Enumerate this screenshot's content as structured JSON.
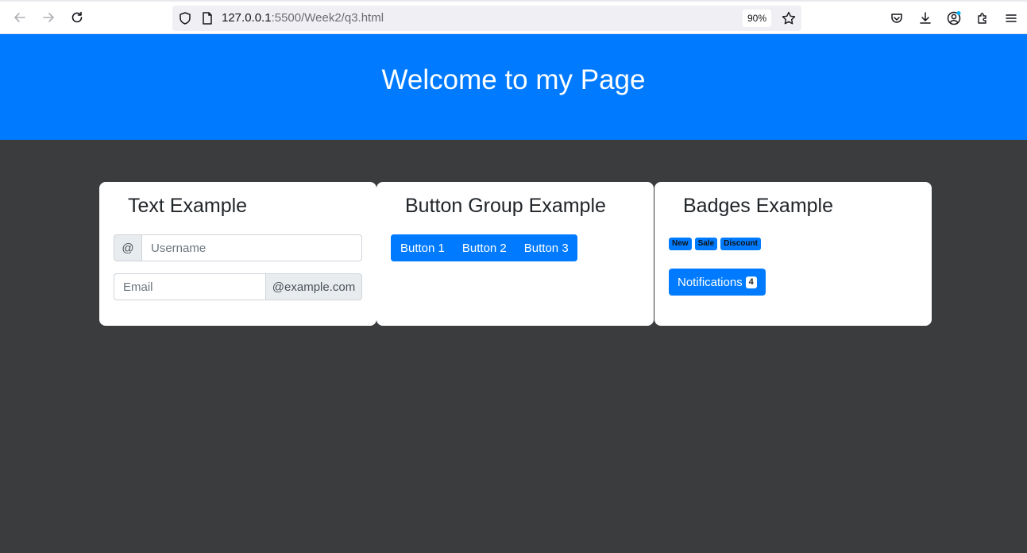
{
  "browser": {
    "url_host": "127.0.0.1",
    "url_path": ":5500/Week2/q3.html",
    "zoom": "90%",
    "icons": [
      "back-icon",
      "forward-icon",
      "reload-icon",
      "shield-icon",
      "page-icon",
      "star-icon",
      "pocket-icon",
      "download-icon",
      "account-icon",
      "extensions-icon",
      "menu-icon"
    ]
  },
  "header": {
    "title": "Welcome to my Page",
    "background": "#007bff"
  },
  "text_card": {
    "title": "Text Example",
    "username_prefix": "@",
    "username_placeholder": "Username",
    "email_placeholder": "Email",
    "email_suffix": "@example.com"
  },
  "button_card": {
    "title": "Button Group Example",
    "buttons": [
      "Button 1",
      "Button 2",
      "Button 3"
    ]
  },
  "badges_card": {
    "title": "Badges Example",
    "badges": [
      "New",
      "Sale",
      "Discount"
    ],
    "notifications_label": "Notifications",
    "notifications_count": "4"
  },
  "colors": {
    "primary": "#007bff",
    "page_background": "#3b3c3e",
    "card_background": "#ffffff"
  }
}
